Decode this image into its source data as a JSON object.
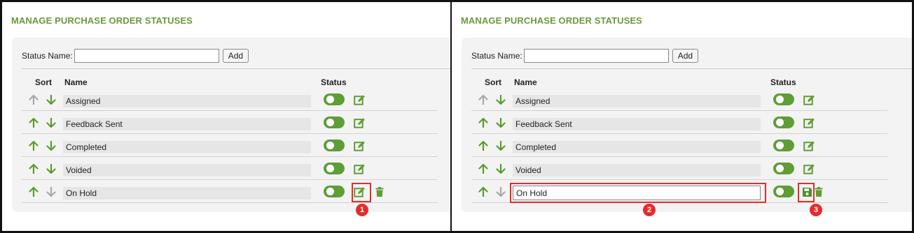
{
  "section_title": "MANAGE PURCHASE ORDER STATUSES",
  "add_form": {
    "label": "Status Name:",
    "input_value": "",
    "button_label": "Add"
  },
  "columns": {
    "sort": "Sort",
    "name": "Name",
    "status": "Status"
  },
  "rows": [
    {
      "name": "Assigned",
      "active": true
    },
    {
      "name": "Feedback Sent",
      "active": true
    },
    {
      "name": "Completed",
      "active": true
    },
    {
      "name": "Voided",
      "active": true
    },
    {
      "name": "On Hold",
      "active": true
    }
  ],
  "editing_value": "On Hold",
  "steps": [
    "1",
    "2",
    "3"
  ],
  "colors": {
    "accent_green": "#6a9a3a",
    "toggle_green": "#5f9d36",
    "arrow_green": "#5a9c2e",
    "arrow_disabled": "#a8a8a8",
    "highlight_red": "#e52c2c"
  }
}
